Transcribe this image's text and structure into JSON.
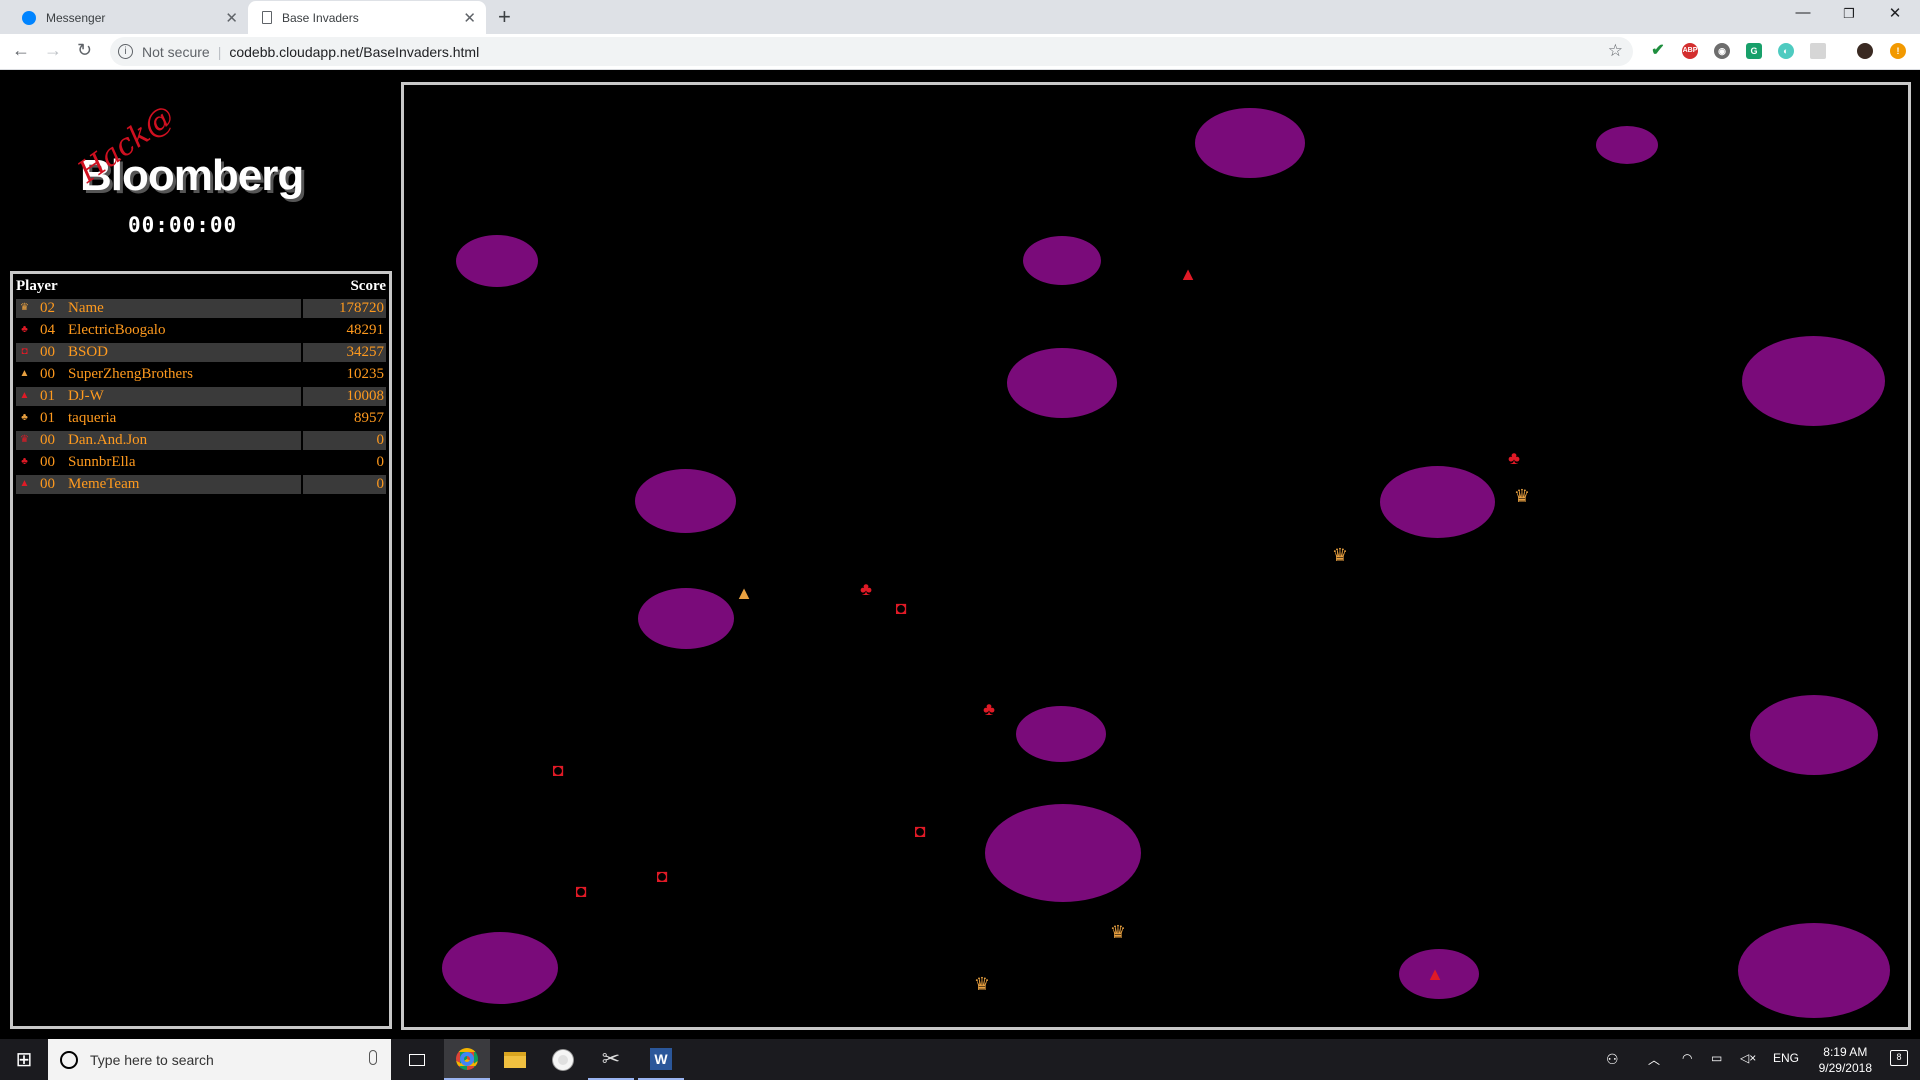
{
  "browser": {
    "tabs": [
      {
        "title": "Messenger",
        "icon": "messenger-icon",
        "active": false
      },
      {
        "title": "Base Invaders",
        "icon": "page-icon",
        "active": true
      }
    ],
    "security_label": "Not secure",
    "url": "codebb.cloudapp.net/BaseInvaders.html",
    "extension_icons": [
      "check-extension-icon",
      "adblock-icon",
      "gray-extension-icon",
      "green-extension-icon",
      "teal-extension-icon",
      "gray-square-extension-icon",
      "profile-avatar-icon",
      "update-icon"
    ]
  },
  "game": {
    "logo": {
      "text": "Bloomberg",
      "scrawl": "Hack@"
    },
    "timer": "00:00:00",
    "leaderboard": {
      "header": {
        "player": "Player",
        "score": "Score"
      },
      "rows": [
        {
          "level": "02",
          "name": "Name",
          "score": "178720"
        },
        {
          "level": "04",
          "name": "ElectricBoogalo",
          "score": "48291"
        },
        {
          "level": "00",
          "name": "BSOD",
          "score": "34257"
        },
        {
          "level": "00",
          "name": "SuperZhengBrothers",
          "score": "10235"
        },
        {
          "level": "01",
          "name": "DJ-W",
          "score": "10008"
        },
        {
          "level": "01",
          "name": "taqueria",
          "score": "8957"
        },
        {
          "level": "00",
          "name": "Dan.And.Jon",
          "score": "0"
        },
        {
          "level": "00",
          "name": "SunnbrElla",
          "score": "0"
        },
        {
          "level": "00",
          "name": "MemeTeam",
          "score": "0"
        }
      ]
    },
    "colors": {
      "planet": "#7a0b7a",
      "ship_red": "#e01a26",
      "ship_orange": "#e8a040",
      "leaderboard_text": "#ff9a1e"
    }
  },
  "taskbar": {
    "search_placeholder": "Type here to search",
    "apps": [
      "task-view-icon",
      "chrome-icon",
      "file-explorer-icon",
      "chrome-canary-icon",
      "snipping-tool-icon",
      "word-icon"
    ],
    "language": "ENG",
    "time": "8:19 AM",
    "date": "9/29/2018",
    "notification_count": "8"
  }
}
